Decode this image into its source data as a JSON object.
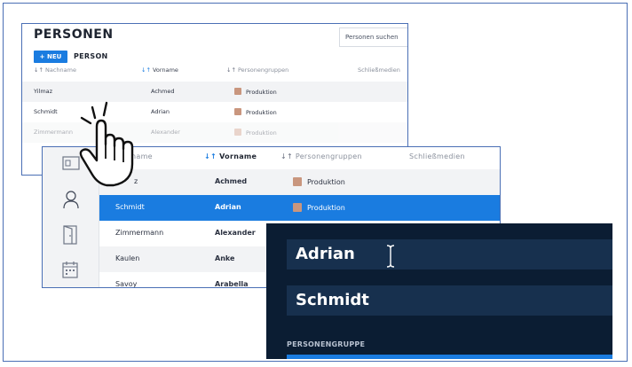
{
  "panel_list": {
    "title": "PERSONEN",
    "search_placeholder": "Personen suchen",
    "new_button": "+ NEU",
    "subtitle": "PERSON",
    "columns": [
      {
        "arrow": "↓↑",
        "label": "Nachname"
      },
      {
        "arrow": "↓↑",
        "label": "Vorname"
      },
      {
        "arrow": "↓↑",
        "label": "Personengruppen"
      },
      {
        "arrow": "",
        "label": "Schließmedien"
      }
    ],
    "rows": [
      {
        "nachname": "Yilmaz",
        "vorname": "Achmed",
        "gruppe": "Produktion"
      },
      {
        "nachname": "Schmidt",
        "vorname": "Adrian",
        "gruppe": "Produktion"
      },
      {
        "nachname": "Zimmermann",
        "vorname": "Alexander",
        "gruppe": "Produktion"
      }
    ]
  },
  "panel_table": {
    "columns": [
      {
        "arrow": "",
        "label": "name"
      },
      {
        "arrow": "↓↑",
        "label": "Vorname"
      },
      {
        "arrow": "↓↑",
        "label": "Personengruppen"
      },
      {
        "arrow": "",
        "label": "Schließmedien"
      }
    ],
    "rows": [
      {
        "nachname": "z",
        "vorname": "Achmed",
        "gruppe": "Produktion"
      },
      {
        "nachname": "Schmidt",
        "vorname": "Adrian",
        "gruppe": "Produktion",
        "selected": true
      },
      {
        "nachname": "Zimmermann",
        "vorname": "Alexander",
        "gruppe": ""
      },
      {
        "nachname": "Kaulen",
        "vorname": "Anke",
        "gruppe": ""
      },
      {
        "nachname": "Savoy",
        "vorname": "Arabella",
        "gruppe": ""
      }
    ],
    "sidebar_icons": [
      "id-card-icon",
      "person-icon",
      "door-icon",
      "calendar-icon"
    ]
  },
  "panel_detail": {
    "first_name": "Adrian",
    "last_name": "Schmidt",
    "group_label": "PERSONENGRUPPE"
  },
  "colors": {
    "accent": "#1a7ce0",
    "dark_bg": "#0b1d33",
    "field_bg": "#17304e",
    "group_swatch": "#c9967e"
  }
}
